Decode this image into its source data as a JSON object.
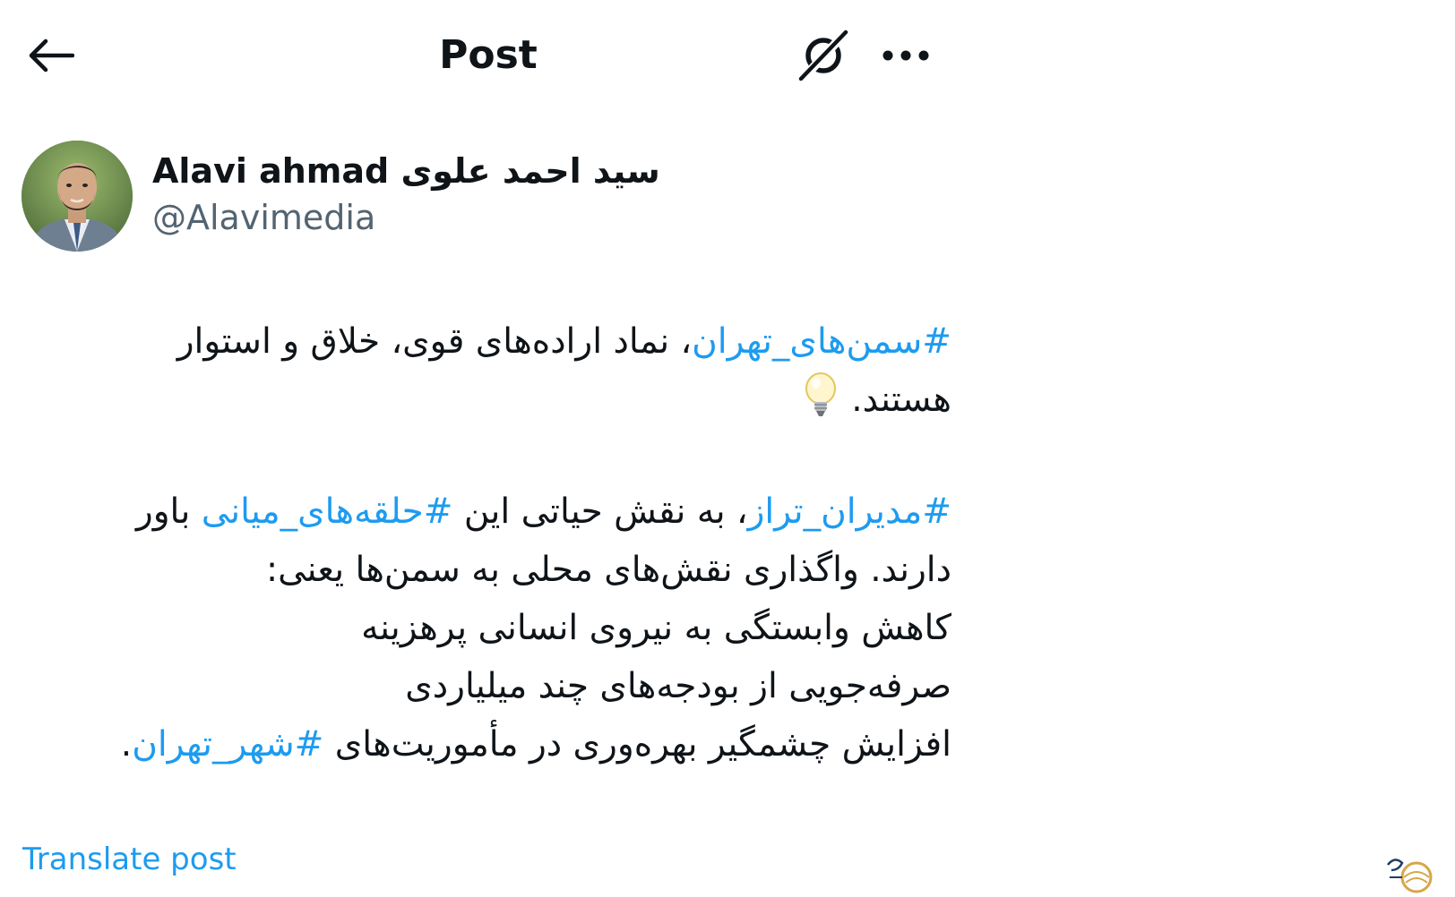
{
  "header": {
    "title": "Post",
    "back_icon": "arrow-left-icon",
    "grok_icon": "grok-icon",
    "more_icon": "more-dots-icon"
  },
  "author": {
    "display_name": "سید احمد علوی Alavi ahmad",
    "handle": "@Alavimedia"
  },
  "post": {
    "line1_tag": "#سمن‌های_تهران",
    "line1_text": "، نماد اراده‌های قوی، خلاق و استوار",
    "line2_text": "هستند.",
    "line2_emoji_icon": "light-bulb-icon",
    "line3_tag1": "#مدیران_تراز",
    "line3_text1": "، به نقش حیاتی این ",
    "line3_tag2": "#حلقه‌های_میانی",
    "line3_text2": " باور",
    "line4_text": "دارند. واگذاری نقش‌های محلی به سمن‌ها یعنی:",
    "line5_text": "کاهش وابستگی به نیروی انسانی پرهزینه",
    "line6_text": "صرفه‌جویی از بودجه‌های چند میلیاردی",
    "line7_text": "افزایش چشمگیر بهره‌وری در مأموریت‌های ",
    "line7_tag": "#شهر_تهران",
    "line7_end": "."
  },
  "translate_label": "Translate post",
  "colors": {
    "link": "#1d9bf0",
    "text": "#0f1419",
    "secondary": "#536471"
  }
}
